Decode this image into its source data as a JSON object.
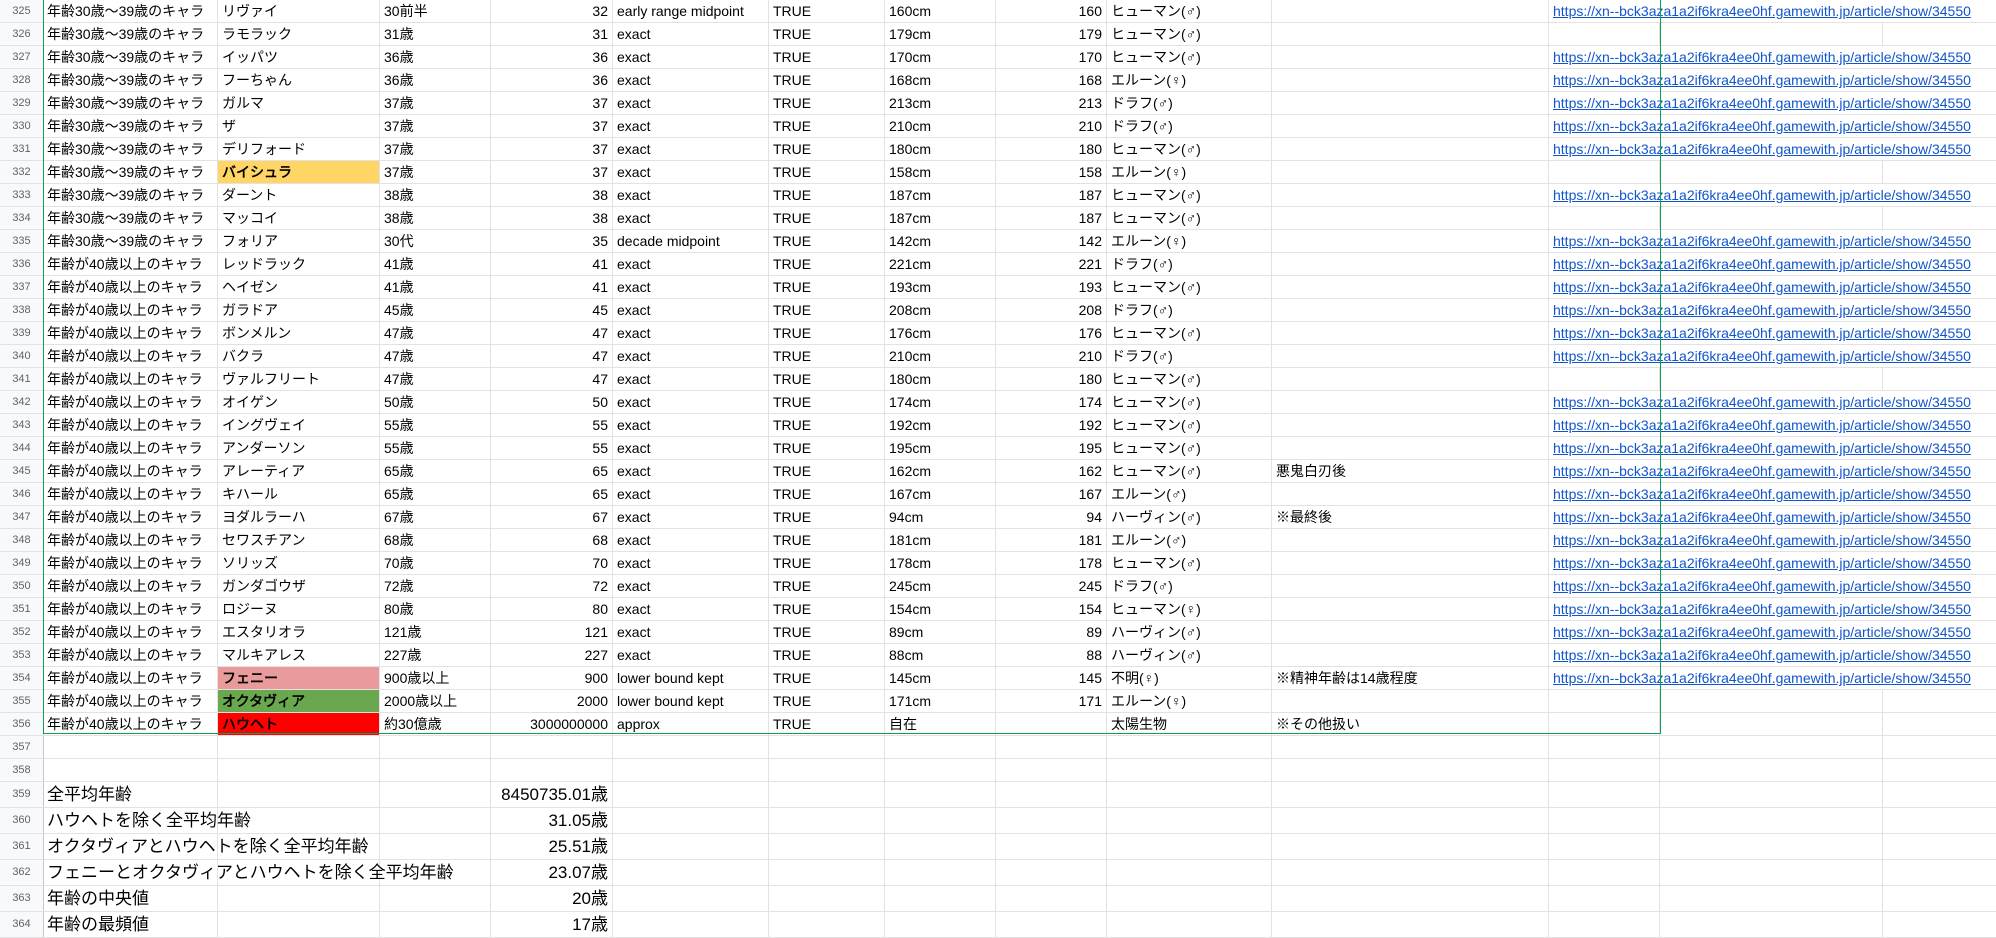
{
  "rows": [
    {
      "rn": "325",
      "group": "年齢30歳〜39歳のキャラ",
      "name": "リヴァイ",
      "age_text": "30前半",
      "age": "32",
      "method": "early range midpoint",
      "flag": "TRUE",
      "height_text": "160cm",
      "height": "160",
      "race": "ヒューマン(♂)",
      "note": "",
      "link": "https://xn--bck3aza1a2if6kra4ee0hf.gamewith.jp/article/show/34550"
    },
    {
      "rn": "326",
      "group": "年齢30歳〜39歳のキャラ",
      "name": "ラモラック",
      "age_text": "31歳",
      "age": "31",
      "method": "exact",
      "flag": "TRUE",
      "height_text": "179cm",
      "height": "179",
      "race": "ヒューマン(♂)",
      "note": "",
      "link": ""
    },
    {
      "rn": "327",
      "group": "年齢30歳〜39歳のキャラ",
      "name": "イッパツ",
      "age_text": "36歳",
      "age": "36",
      "method": "exact",
      "flag": "TRUE",
      "height_text": "170cm",
      "height": "170",
      "race": "ヒューマン(♂)",
      "note": "",
      "link": "https://xn--bck3aza1a2if6kra4ee0hf.gamewith.jp/article/show/34550"
    },
    {
      "rn": "328",
      "group": "年齢30歳〜39歳のキャラ",
      "name": "フーちゃん",
      "age_text": "36歳",
      "age": "36",
      "method": "exact",
      "flag": "TRUE",
      "height_text": "168cm",
      "height": "168",
      "race": "エルーン(♀)",
      "note": "",
      "link": "https://xn--bck3aza1a2if6kra4ee0hf.gamewith.jp/article/show/34550"
    },
    {
      "rn": "329",
      "group": "年齢30歳〜39歳のキャラ",
      "name": "ガルマ",
      "age_text": "37歳",
      "age": "37",
      "method": "exact",
      "flag": "TRUE",
      "height_text": "213cm",
      "height": "213",
      "race": "ドラフ(♂)",
      "note": "",
      "link": "https://xn--bck3aza1a2if6kra4ee0hf.gamewith.jp/article/show/34550"
    },
    {
      "rn": "330",
      "group": "年齢30歳〜39歳のキャラ",
      "name": "ザ",
      "age_text": "37歳",
      "age": "37",
      "method": "exact",
      "flag": "TRUE",
      "height_text": "210cm",
      "height": "210",
      "race": "ドラフ(♂)",
      "note": "",
      "link": "https://xn--bck3aza1a2if6kra4ee0hf.gamewith.jp/article/show/34550"
    },
    {
      "rn": "331",
      "group": "年齢30歳〜39歳のキャラ",
      "name": "デリフォード",
      "age_text": "37歳",
      "age": "37",
      "method": "exact",
      "flag": "TRUE",
      "height_text": "180cm",
      "height": "180",
      "race": "ヒューマン(♂)",
      "note": "",
      "link": "https://xn--bck3aza1a2if6kra4ee0hf.gamewith.jp/article/show/34550"
    },
    {
      "rn": "332",
      "group": "年齢30歳〜39歳のキャラ",
      "name": "バイシュラ",
      "age_text": "37歳",
      "age": "37",
      "method": "exact",
      "flag": "TRUE",
      "height_text": "158cm",
      "height": "158",
      "race": "エルーン(♀)",
      "note": "",
      "link": "",
      "name_bg": "#ffd666"
    },
    {
      "rn": "333",
      "group": "年齢30歳〜39歳のキャラ",
      "name": "ダーント",
      "age_text": "38歳",
      "age": "38",
      "method": "exact",
      "flag": "TRUE",
      "height_text": "187cm",
      "height": "187",
      "race": "ヒューマン(♂)",
      "note": "",
      "link": "https://xn--bck3aza1a2if6kra4ee0hf.gamewith.jp/article/show/34550"
    },
    {
      "rn": "334",
      "group": "年齢30歳〜39歳のキャラ",
      "name": "マッコイ",
      "age_text": "38歳",
      "age": "38",
      "method": "exact",
      "flag": "TRUE",
      "height_text": "187cm",
      "height": "187",
      "race": "ヒューマン(♂)",
      "note": "",
      "link": ""
    },
    {
      "rn": "335",
      "group": "年齢30歳〜39歳のキャラ",
      "name": "フォリア",
      "age_text": "30代",
      "age": "35",
      "method": "decade midpoint",
      "flag": "TRUE",
      "height_text": "142cm",
      "height": "142",
      "race": "エルーン(♀)",
      "note": "",
      "link": "https://xn--bck3aza1a2if6kra4ee0hf.gamewith.jp/article/show/34550"
    },
    {
      "rn": "336",
      "group": "年齢が40歳以上のキャラ",
      "name": "レッドラック",
      "age_text": "41歳",
      "age": "41",
      "method": "exact",
      "flag": "TRUE",
      "height_text": "221cm",
      "height": "221",
      "race": "ドラフ(♂)",
      "note": "",
      "link": "https://xn--bck3aza1a2if6kra4ee0hf.gamewith.jp/article/show/34550"
    },
    {
      "rn": "337",
      "group": "年齢が40歳以上のキャラ",
      "name": "ヘイゼン",
      "age_text": "41歳",
      "age": "41",
      "method": "exact",
      "flag": "TRUE",
      "height_text": "193cm",
      "height": "193",
      "race": "ヒューマン(♂)",
      "note": "",
      "link": "https://xn--bck3aza1a2if6kra4ee0hf.gamewith.jp/article/show/34550"
    },
    {
      "rn": "338",
      "group": "年齢が40歳以上のキャラ",
      "name": "ガラドア",
      "age_text": "45歳",
      "age": "45",
      "method": "exact",
      "flag": "TRUE",
      "height_text": "208cm",
      "height": "208",
      "race": "ドラフ(♂)",
      "note": "",
      "link": "https://xn--bck3aza1a2if6kra4ee0hf.gamewith.jp/article/show/34550"
    },
    {
      "rn": "339",
      "group": "年齢が40歳以上のキャラ",
      "name": "ボンメルン",
      "age_text": "47歳",
      "age": "47",
      "method": "exact",
      "flag": "TRUE",
      "height_text": "176cm",
      "height": "176",
      "race": "ヒューマン(♂)",
      "note": "",
      "link": "https://xn--bck3aza1a2if6kra4ee0hf.gamewith.jp/article/show/34550"
    },
    {
      "rn": "340",
      "group": "年齢が40歳以上のキャラ",
      "name": "バクラ",
      "age_text": "47歳",
      "age": "47",
      "method": "exact",
      "flag": "TRUE",
      "height_text": "210cm",
      "height": "210",
      "race": "ドラフ(♂)",
      "note": "",
      "link": "https://xn--bck3aza1a2if6kra4ee0hf.gamewith.jp/article/show/34550"
    },
    {
      "rn": "341",
      "group": "年齢が40歳以上のキャラ",
      "name": "ヴァルフリート",
      "age_text": "47歳",
      "age": "47",
      "method": "exact",
      "flag": "TRUE",
      "height_text": "180cm",
      "height": "180",
      "race": "ヒューマン(♂)",
      "note": "",
      "link": ""
    },
    {
      "rn": "342",
      "group": "年齢が40歳以上のキャラ",
      "name": "オイゲン",
      "age_text": "50歳",
      "age": "50",
      "method": "exact",
      "flag": "TRUE",
      "height_text": "174cm",
      "height": "174",
      "race": "ヒューマン(♂)",
      "note": "",
      "link": "https://xn--bck3aza1a2if6kra4ee0hf.gamewith.jp/article/show/34550"
    },
    {
      "rn": "343",
      "group": "年齢が40歳以上のキャラ",
      "name": "イングヴェイ",
      "age_text": "55歳",
      "age": "55",
      "method": "exact",
      "flag": "TRUE",
      "height_text": "192cm",
      "height": "192",
      "race": "ヒューマン(♂)",
      "note": "",
      "link": "https://xn--bck3aza1a2if6kra4ee0hf.gamewith.jp/article/show/34550"
    },
    {
      "rn": "344",
      "group": "年齢が40歳以上のキャラ",
      "name": "アンダーソン",
      "age_text": "55歳",
      "age": "55",
      "method": "exact",
      "flag": "TRUE",
      "height_text": "195cm",
      "height": "195",
      "race": "ヒューマン(♂)",
      "note": "",
      "link": "https://xn--bck3aza1a2if6kra4ee0hf.gamewith.jp/article/show/34550"
    },
    {
      "rn": "345",
      "group": "年齢が40歳以上のキャラ",
      "name": "アレーティア",
      "age_text": "65歳",
      "age": "65",
      "method": "exact",
      "flag": "TRUE",
      "height_text": "162cm",
      "height": "162",
      "race": "ヒューマン(♂)",
      "note": "悪鬼白刃後",
      "link": "https://xn--bck3aza1a2if6kra4ee0hf.gamewith.jp/article/show/34550"
    },
    {
      "rn": "346",
      "group": "年齢が40歳以上のキャラ",
      "name": "キハール",
      "age_text": "65歳",
      "age": "65",
      "method": "exact",
      "flag": "TRUE",
      "height_text": "167cm",
      "height": "167",
      "race": "エルーン(♂)",
      "note": "",
      "link": "https://xn--bck3aza1a2if6kra4ee0hf.gamewith.jp/article/show/34550"
    },
    {
      "rn": "347",
      "group": "年齢が40歳以上のキャラ",
      "name": "ヨダルラーハ",
      "age_text": "67歳",
      "age": "67",
      "method": "exact",
      "flag": "TRUE",
      "height_text": "94cm",
      "height": "94",
      "race": "ハーヴィン(♂)",
      "note": "※最終後",
      "link": "https://xn--bck3aza1a2if6kra4ee0hf.gamewith.jp/article/show/34550"
    },
    {
      "rn": "348",
      "group": "年齢が40歳以上のキャラ",
      "name": "セワスチアン",
      "age_text": "68歳",
      "age": "68",
      "method": "exact",
      "flag": "TRUE",
      "height_text": "181cm",
      "height": "181",
      "race": "エルーン(♂)",
      "note": "",
      "link": "https://xn--bck3aza1a2if6kra4ee0hf.gamewith.jp/article/show/34550"
    },
    {
      "rn": "349",
      "group": "年齢が40歳以上のキャラ",
      "name": "ソリッズ",
      "age_text": "70歳",
      "age": "70",
      "method": "exact",
      "flag": "TRUE",
      "height_text": "178cm",
      "height": "178",
      "race": "ヒューマン(♂)",
      "note": "",
      "link": "https://xn--bck3aza1a2if6kra4ee0hf.gamewith.jp/article/show/34550"
    },
    {
      "rn": "350",
      "group": "年齢が40歳以上のキャラ",
      "name": "ガンダゴウザ",
      "age_text": "72歳",
      "age": "72",
      "method": "exact",
      "flag": "TRUE",
      "height_text": "245cm",
      "height": "245",
      "race": "ドラフ(♂)",
      "note": "",
      "link": "https://xn--bck3aza1a2if6kra4ee0hf.gamewith.jp/article/show/34550"
    },
    {
      "rn": "351",
      "group": "年齢が40歳以上のキャラ",
      "name": "ロジーヌ",
      "age_text": "80歳",
      "age": "80",
      "method": "exact",
      "flag": "TRUE",
      "height_text": "154cm",
      "height": "154",
      "race": "ヒューマン(♀)",
      "note": "",
      "link": "https://xn--bck3aza1a2if6kra4ee0hf.gamewith.jp/article/show/34550"
    },
    {
      "rn": "352",
      "group": "年齢が40歳以上のキャラ",
      "name": "エスタリオラ",
      "age_text": "121歳",
      "age": "121",
      "method": "exact",
      "flag": "TRUE",
      "height_text": "89cm",
      "height": "89",
      "race": "ハーヴィン(♂)",
      "note": "",
      "link": "https://xn--bck3aza1a2if6kra4ee0hf.gamewith.jp/article/show/34550"
    },
    {
      "rn": "353",
      "group": "年齢が40歳以上のキャラ",
      "name": "マルキアレス",
      "age_text": "227歳",
      "age": "227",
      "method": "exact",
      "flag": "TRUE",
      "height_text": "88cm",
      "height": "88",
      "race": "ハーヴィン(♂)",
      "note": "",
      "link": "https://xn--bck3aza1a2if6kra4ee0hf.gamewith.jp/article/show/34550"
    },
    {
      "rn": "354",
      "group": "年齢が40歳以上のキャラ",
      "name": "フェニー",
      "age_text": "900歳以上",
      "age": "900",
      "method": "lower bound kept",
      "flag": "TRUE",
      "height_text": "145cm",
      "height": "145",
      "race": "不明(♀)",
      "note": "※精神年齢は14歳程度",
      "link": "https://xn--bck3aza1a2if6kra4ee0hf.gamewith.jp/article/show/34550",
      "name_bg": "#e99b9b"
    },
    {
      "rn": "355",
      "group": "年齢が40歳以上のキャラ",
      "name": "オクタヴィア",
      "age_text": "2000歳以上",
      "age": "2000",
      "method": "lower bound kept",
      "flag": "TRUE",
      "height_text": "171cm",
      "height": "171",
      "race": "エルーン(♀)",
      "note": "",
      "link": "",
      "name_bg": "#6aa84f"
    },
    {
      "rn": "356",
      "group": "年齢が40歳以上のキャラ",
      "name": "ハウヘト",
      "age_text": "約30億歳",
      "age": "3000000000",
      "method": "approx",
      "flag": "TRUE",
      "height_text": "自在",
      "height": "",
      "race": "太陽生物",
      "note": "※その他扱い",
      "link": "",
      "name_bg": "#ff0000"
    }
  ],
  "blank_rows": [
    "357",
    "358"
  ],
  "summary": [
    {
      "rn": "359",
      "label": "全平均年齢",
      "value": "8450735.01歳"
    },
    {
      "rn": "360",
      "label": "ハウヘトを除く全平均年齢",
      "value": "31.05歳"
    },
    {
      "rn": "361",
      "label": "オクタヴィアとハウヘトを除く全平均年齢",
      "value": "25.51歳"
    },
    {
      "rn": "362",
      "label": "フェニーとオクタヴィアとハウヘトを除く全平均年齢",
      "value": "23.07歳"
    },
    {
      "rn": "363",
      "label": "年齢の中央値",
      "value": "20歳"
    },
    {
      "rn": "364",
      "label": "年齢の最頻値",
      "value": "17歳"
    }
  ]
}
